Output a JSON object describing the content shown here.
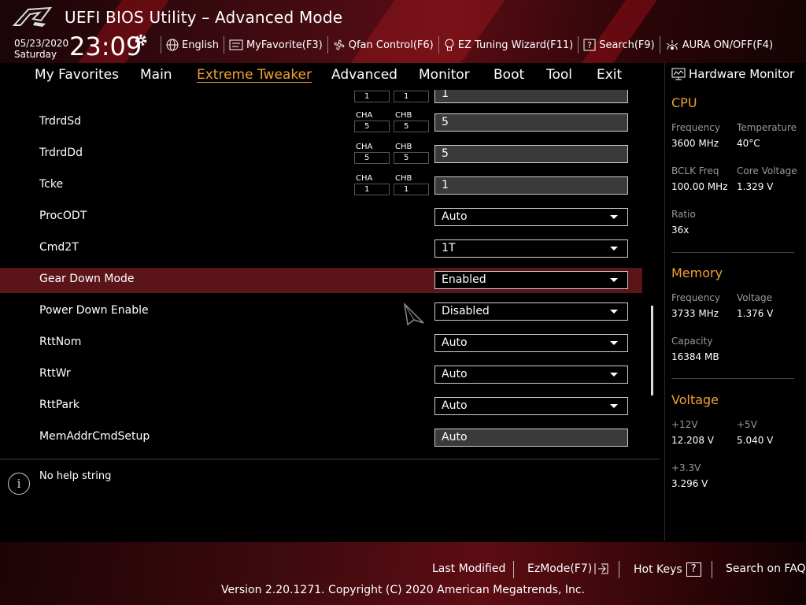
{
  "header": {
    "title": "UEFI BIOS Utility – Advanced Mode",
    "date": "05/23/2020",
    "day": "Saturday",
    "time": "23:09",
    "toolbar": {
      "language": "English",
      "myfavorite": "MyFavorite(F3)",
      "qfan": "Qfan Control(F6)",
      "ez_tuning": "EZ Tuning Wizard(F11)",
      "search": "Search(F9)",
      "aura": "AURA ON/OFF(F4)"
    }
  },
  "nav": {
    "tabs": [
      {
        "label": "My Favorites"
      },
      {
        "label": "Main"
      },
      {
        "label": "Extreme Tweaker"
      },
      {
        "label": "Advanced"
      },
      {
        "label": "Monitor"
      },
      {
        "label": "Boot"
      },
      {
        "label": "Tool"
      },
      {
        "label": "Exit"
      }
    ],
    "active": "Extreme Tweaker"
  },
  "settings": {
    "partial_row": {
      "cha": "1",
      "chb": "1",
      "value": "1"
    },
    "rows": [
      {
        "label": "TrdrdSd",
        "cha_label": "CHA",
        "cha": "5",
        "chb_label": "CHB",
        "chb": "5",
        "value": "5"
      },
      {
        "label": "TrdrdDd",
        "cha_label": "CHA",
        "cha": "5",
        "chb_label": "CHB",
        "chb": "5",
        "value": "5"
      },
      {
        "label": "Tcke",
        "cha_label": "CHA",
        "cha": "1",
        "chb_label": "CHB",
        "chb": "1",
        "value": "1"
      },
      {
        "label": "ProcODT",
        "value": "Auto"
      },
      {
        "label": "Cmd2T",
        "value": "1T"
      },
      {
        "label": "Gear Down Mode",
        "value": "Enabled"
      },
      {
        "label": "Power Down Enable",
        "value": "Disabled"
      },
      {
        "label": "RttNom",
        "value": "Auto"
      },
      {
        "label": "RttWr",
        "value": "Auto"
      },
      {
        "label": "RttPark",
        "value": "Auto"
      },
      {
        "label": "MemAddrCmdSetup",
        "value": "Auto"
      }
    ]
  },
  "help": {
    "text": "No help string"
  },
  "hardware_monitor": {
    "title": "Hardware Monitor",
    "cpu": {
      "heading": "CPU",
      "frequency_label": "Frequency",
      "frequency": "3600 MHz",
      "temperature_label": "Temperature",
      "temperature": "40°C",
      "bclk_label": "BCLK Freq",
      "bclk": "100.00 MHz",
      "core_voltage_label": "Core Voltage",
      "core_voltage": "1.329 V",
      "ratio_label": "Ratio",
      "ratio": "36x"
    },
    "memory": {
      "heading": "Memory",
      "frequency_label": "Frequency",
      "frequency": "3733 MHz",
      "voltage_label": "Voltage",
      "voltage": "1.376 V",
      "capacity_label": "Capacity",
      "capacity": "16384 MB"
    },
    "voltage": {
      "heading": "Voltage",
      "v12_label": "+12V",
      "v12": "12.208 V",
      "v5_label": "+5V",
      "v5": "5.040 V",
      "v33_label": "+3.3V",
      "v33": "3.296 V"
    }
  },
  "footer": {
    "last_modified": "Last Modified",
    "ezmode": "EzMode(F7)",
    "hot_keys": "Hot Keys",
    "hot_keys_badge": "?",
    "search_faq": "Search on FAQ",
    "version": "Version 2.20.1271. Copyright (C) 2020 American Megatrends, Inc."
  },
  "colors": {
    "accent": "#f0a030",
    "selected_row": "#5b1418"
  }
}
